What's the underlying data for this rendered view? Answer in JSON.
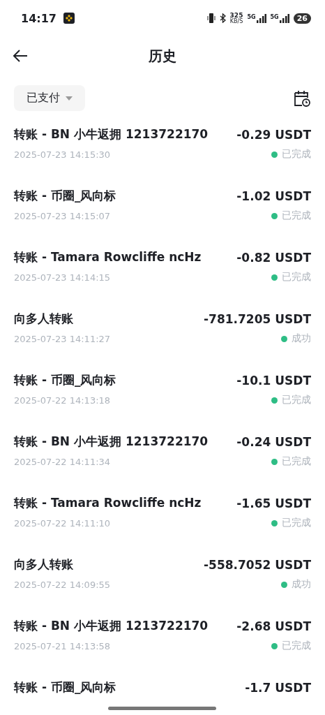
{
  "status_bar": {
    "time": "14:17",
    "speed": "325",
    "speed_unit": "KB/S",
    "network_1": "5G",
    "network_2": "5G",
    "battery": "26"
  },
  "header": {
    "title": "历史"
  },
  "filter": {
    "label": "已支付"
  },
  "transactions": [
    {
      "title": "转账 - BN 小牛返拥 1213722170",
      "amount": "-0.29 USDT",
      "date": "2025-07-23 14:15:30",
      "status": "已完成"
    },
    {
      "title": "转账 - 币圈_风向标",
      "amount": "-1.02 USDT",
      "date": "2025-07-23 14:15:07",
      "status": "已完成"
    },
    {
      "title": "转账 - Tamara Rowcliffe ncHz",
      "amount": "-0.82 USDT",
      "date": "2025-07-23 14:14:15",
      "status": "已完成"
    },
    {
      "title": "向多人转账",
      "amount": "-781.7205 USDT",
      "date": "2025-07-23 14:11:27",
      "status": "成功"
    },
    {
      "title": "转账 - 币圈_风向标",
      "amount": "-10.1 USDT",
      "date": "2025-07-22 14:13:18",
      "status": "已完成"
    },
    {
      "title": "转账 - BN 小牛返拥 1213722170",
      "amount": "-0.24 USDT",
      "date": "2025-07-22 14:11:34",
      "status": "已完成"
    },
    {
      "title": "转账 - Tamara Rowcliffe ncHz",
      "amount": "-1.65 USDT",
      "date": "2025-07-22 14:11:10",
      "status": "已完成"
    },
    {
      "title": "向多人转账",
      "amount": "-558.7052 USDT",
      "date": "2025-07-22 14:09:55",
      "status": "成功"
    },
    {
      "title": "转账 - BN 小牛返拥 1213722170",
      "amount": "-2.68 USDT",
      "date": "2025-07-21 14:13:58",
      "status": "已完成"
    },
    {
      "title": "转账 - 币圈_风向标",
      "amount": "-1.7 USDT"
    }
  ]
}
